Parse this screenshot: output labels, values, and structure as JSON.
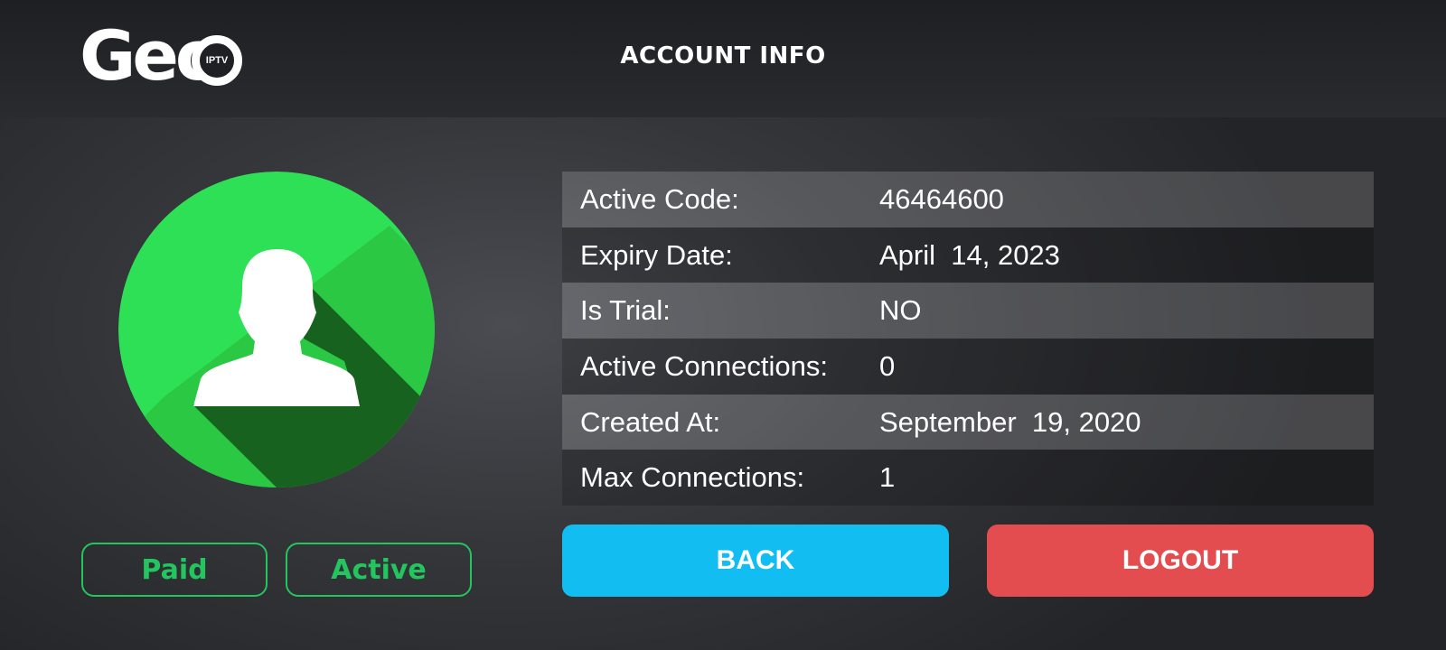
{
  "header": {
    "logo_text": "Geo",
    "logo_badge": "IPTV",
    "title": "ACCOUNT INFO"
  },
  "avatar": {
    "icon": "user-icon",
    "color": "#2ee055",
    "shadow_color": "#17621f"
  },
  "status_badges": {
    "paid": "Paid",
    "active": "Active",
    "color": "#22c55e"
  },
  "account": {
    "rows": [
      {
        "label": "Active Code:",
        "value": "46464600"
      },
      {
        "label": "Expiry Date:",
        "value": "April  14, 2023"
      },
      {
        "label": "Is Trial:",
        "value": "NO"
      },
      {
        "label": "Active Connections:",
        "value": "0"
      },
      {
        "label": "Created At:",
        "value": "September  19, 2020"
      },
      {
        "label": "Max Connections:",
        "value": "1"
      }
    ]
  },
  "actions": {
    "back_label": "BACK",
    "logout_label": "LOGOUT",
    "back_color": "#12bdf1",
    "logout_color": "#e44d4f"
  }
}
